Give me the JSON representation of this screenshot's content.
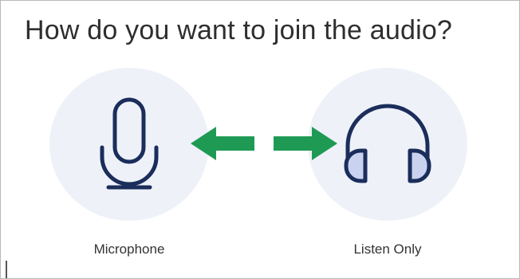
{
  "dialog": {
    "title": "How do you want to join the audio?"
  },
  "options": [
    {
      "label": "Microphone",
      "icon": "microphone-icon"
    },
    {
      "label": "Listen Only",
      "icon": "headphones-icon"
    }
  ],
  "annotations": {
    "arrow_color": "#1e9a55",
    "arrows": [
      "arrow-left-icon",
      "arrow-right-icon"
    ]
  },
  "colors": {
    "icon_stroke": "#1b2d5b",
    "icon_fill": "#c9d3ef",
    "circle_bg": "#eef2f8"
  }
}
